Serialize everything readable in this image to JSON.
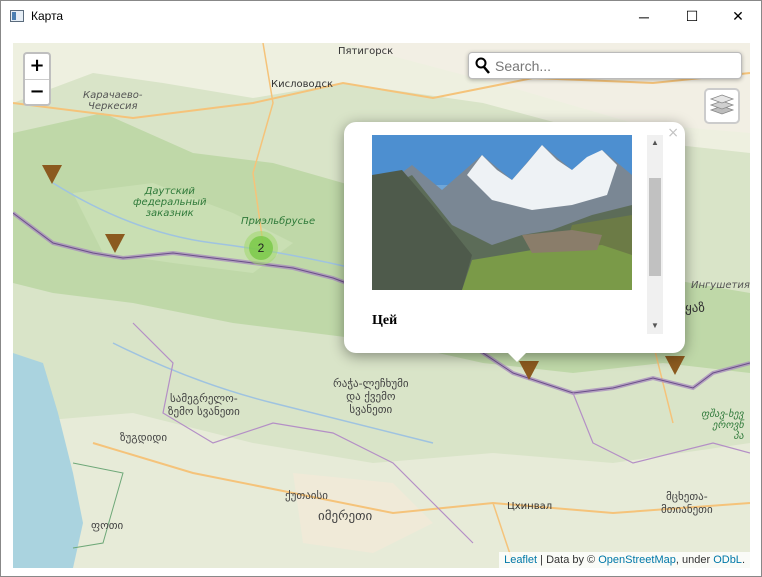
{
  "window": {
    "title": "Карта",
    "minimize_glyph": "─",
    "maximize_glyph": "☐",
    "close_glyph": "✕"
  },
  "map": {
    "zoom_in_label": "+",
    "zoom_out_label": "−",
    "search_placeholder": "Search...",
    "labels": {
      "pyatigorsk": "Пятигорск",
      "kislovodsk": "Кисловодск",
      "karachay": "Карачаево-\nЧеркесия",
      "dautsky": "Даутский\nфедеральный\nзаказник",
      "prielbrusye": "Приэльбрусье",
      "ingushetia": "Ингушетия",
      "samegrelo": "სამეგრელო-\nზემო სვანეთი",
      "racha": "რაჭა-ლეჩხუმი\nდა ქვემო\nსვანეთი",
      "zugdidi": "ზუგდიდი",
      "kutaisi": "ქუთაისი",
      "imereti": "იმერეთი",
      "tskhinval": "Цхинвал",
      "poti": "ფოთი",
      "mtskheta": "მცხეთა-\nმთიანეთი",
      "ka_east": "ყაზ",
      "ka_green": "ფშავ-ხევ\nეროვნ\nპა"
    },
    "cluster_count": "2",
    "popup": {
      "title": "Цей",
      "close_glyph": "×"
    },
    "attribution": {
      "leaflet": "Leaflet",
      "sep": " | Data by © ",
      "osm": "OpenStreetMap",
      "under": ", under ",
      "odbl": "ODbL",
      "end": "."
    }
  },
  "colors": {
    "marker": "#8b5a1f",
    "cluster": "#78c846",
    "border_purple": "#9b7fb0",
    "sea": "#aad3df"
  }
}
